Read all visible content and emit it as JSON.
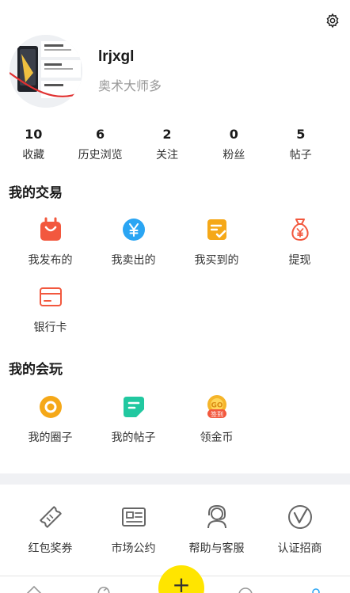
{
  "profile": {
    "username": "lrjxgl",
    "title": "奥术大师多"
  },
  "stats": [
    {
      "num": "10",
      "label": "收藏"
    },
    {
      "num": "6",
      "label": "历史浏览"
    },
    {
      "num": "2",
      "label": "关注"
    },
    {
      "num": "0",
      "label": "粉丝"
    },
    {
      "num": "5",
      "label": "帖子"
    }
  ],
  "trade": {
    "title": "我的交易",
    "items": [
      {
        "label": "我发布的",
        "icon": "shopping-bag-icon"
      },
      {
        "label": "我卖出的",
        "icon": "yen-coin-icon"
      },
      {
        "label": "我买到的",
        "icon": "checklist-icon"
      },
      {
        "label": "提现",
        "icon": "money-bag-icon"
      },
      {
        "label": "银行卡",
        "icon": "bank-card-icon"
      }
    ]
  },
  "play": {
    "title": "我的会玩",
    "items": [
      {
        "label": "我的圈子",
        "icon": "circle-icon"
      },
      {
        "label": "我的帖子",
        "icon": "post-icon"
      },
      {
        "label": "领金币",
        "icon": "gold-coin-icon",
        "badge": "签到"
      }
    ]
  },
  "services": [
    {
      "label": "红包奖券",
      "icon": "ticket-icon"
    },
    {
      "label": "市场公约",
      "icon": "id-card-icon"
    },
    {
      "label": "帮助与客服",
      "icon": "headset-icon"
    },
    {
      "label": "认证招商",
      "icon": "verified-icon"
    }
  ],
  "tabbar": {
    "fab_label": "+",
    "tabs": [
      "home-icon",
      "discover-icon",
      "message-icon",
      "profile-icon"
    ]
  },
  "colors": {
    "accent_yellow": "#ffe500",
    "orange_red": "#f2583e",
    "blue": "#2aa5f3",
    "amber": "#f5a818",
    "green": "#21c8a0"
  }
}
